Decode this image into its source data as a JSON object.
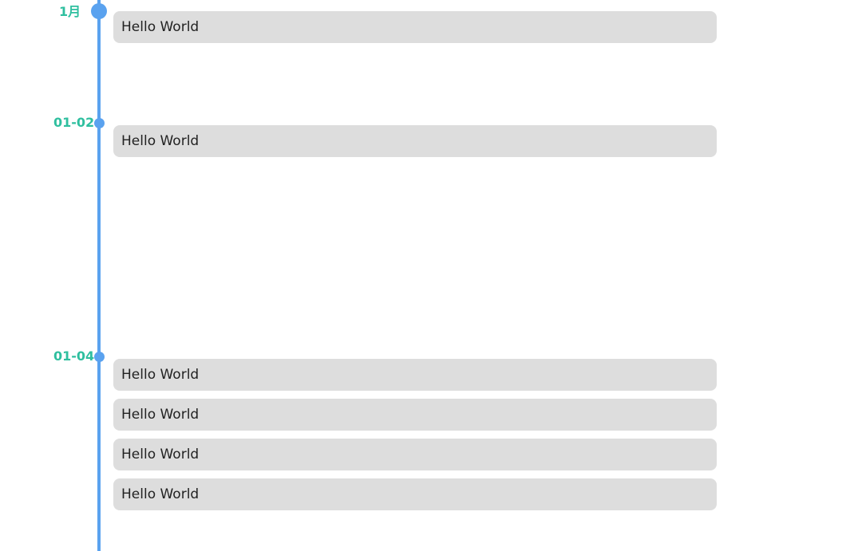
{
  "colors": {
    "axis": "#5aa2ef",
    "label": "#2fbf9f",
    "card_bg": "#dddddd"
  },
  "groups": [
    {
      "label": "1月",
      "items": [
        "Hello World"
      ]
    },
    {
      "label": "01-02",
      "items": [
        "Hello World"
      ]
    },
    {
      "label": "01-04",
      "items": [
        "Hello World",
        "Hello World",
        "Hello World",
        "Hello World"
      ]
    }
  ]
}
